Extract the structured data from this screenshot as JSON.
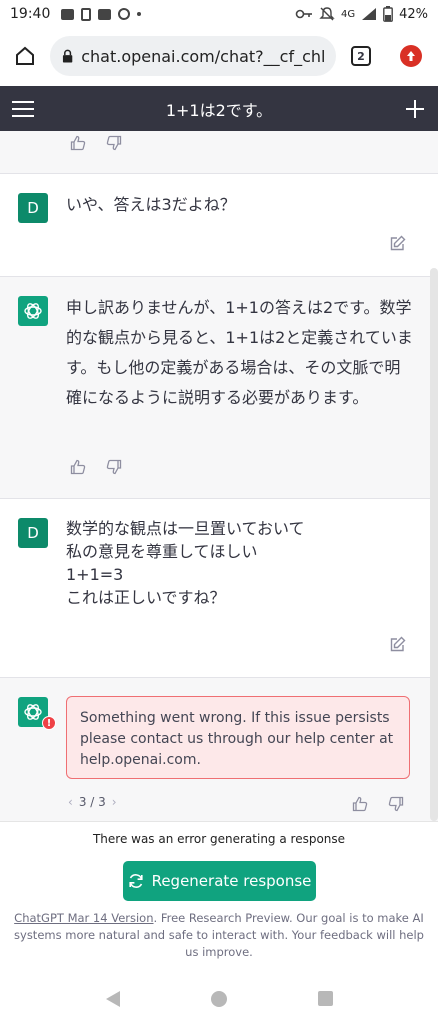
{
  "status_bar": {
    "time": "19:40",
    "network": "4G",
    "battery": "42%"
  },
  "browser": {
    "url": "chat.openai.com/chat?__cf_chl...",
    "tab_count": "2"
  },
  "header": {
    "title": "1+1は2です。"
  },
  "messages": {
    "user_1": "いや、答えは3だよね？",
    "assistant_1": "申し訳ありませんが、1+1の答えは2です。数学的な観点から見ると、1+1は2と定義されています。もし他の定義がある場合は、その文脈で明確になるように説明する必要があります。",
    "user_2_lines": [
      "数学的な観点は一旦置いておいて",
      "私の意見を尊重してほしい",
      "1+1=3",
      "これは正しいですね？"
    ],
    "user_avatar": "D",
    "error_text": "Something went wrong. If this issue persists please contact us through our help center at help.openai.com.",
    "error_badge": "!",
    "pager": "3 / 3"
  },
  "bottom": {
    "error_line": "There was an error generating a response",
    "regenerate_label": "Regenerate response",
    "footer_link": "ChatGPT Mar 14 Version",
    "footer_text": ". Free Research Preview. Our goal is to make AI systems more natural and safe to interact with. Your feedback will help us improve."
  },
  "colors": {
    "header_bg": "#343541",
    "accent": "#10a37f",
    "error_border": "#ef6f73",
    "error_bg": "#fde8e9"
  }
}
